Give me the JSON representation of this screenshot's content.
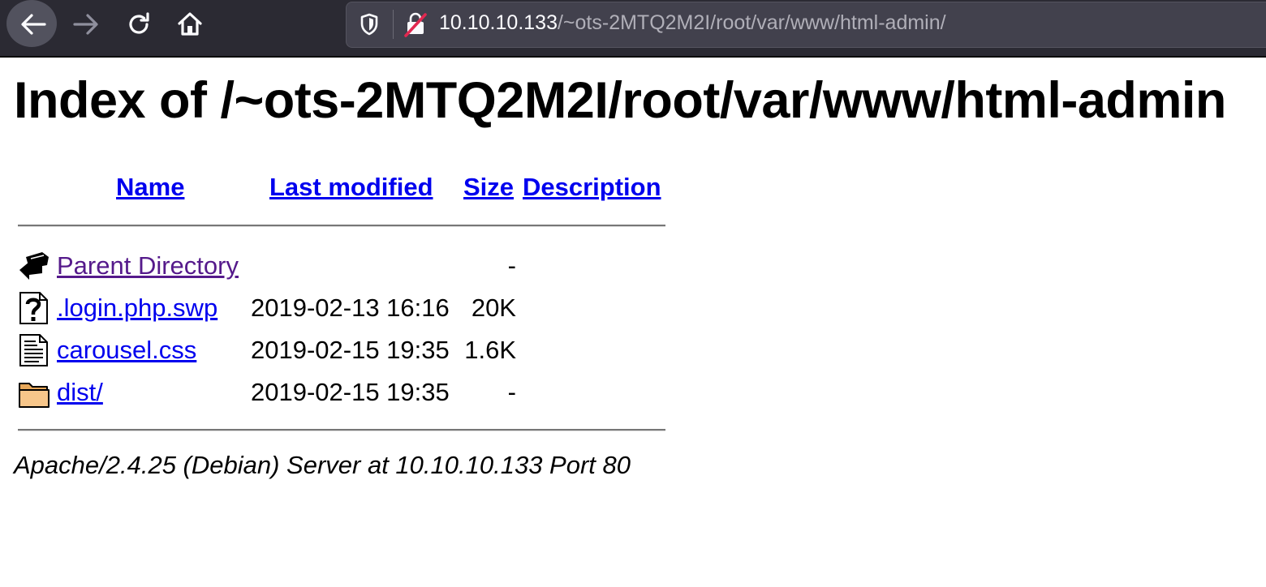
{
  "browser": {
    "url_host": "10.10.10.133",
    "url_path": "/~ots-2MTQ2M2I/root/var/www/html-admin/"
  },
  "page": {
    "heading": "Index of /~ots-2MTQ2M2I/root/var/www/html-admin",
    "columns": {
      "name": "Name",
      "last_modified": "Last modified",
      "size": "Size",
      "description": "Description"
    },
    "rows": [
      {
        "icon": "back-arrow-icon",
        "name": "Parent Directory",
        "modified": "",
        "size": "-",
        "description": ""
      },
      {
        "icon": "unknown-file-icon",
        "name": ".login.php.swp",
        "modified": "2019-02-13 16:16",
        "size": "20K",
        "description": ""
      },
      {
        "icon": "text-file-icon",
        "name": "carousel.css",
        "modified": "2019-02-15 19:35",
        "size": "1.6K",
        "description": ""
      },
      {
        "icon": "folder-icon",
        "name": "dist/",
        "modified": "2019-02-15 19:35",
        "size": "-",
        "description": ""
      }
    ],
    "footer": "Apache/2.4.25 (Debian) Server at 10.10.10.133 Port 80"
  },
  "colors": {
    "toolbar_bg": "#2b2a33",
    "urlbar_bg": "#42414d",
    "link": "#0000ee",
    "visited_link": "#551a8b"
  }
}
